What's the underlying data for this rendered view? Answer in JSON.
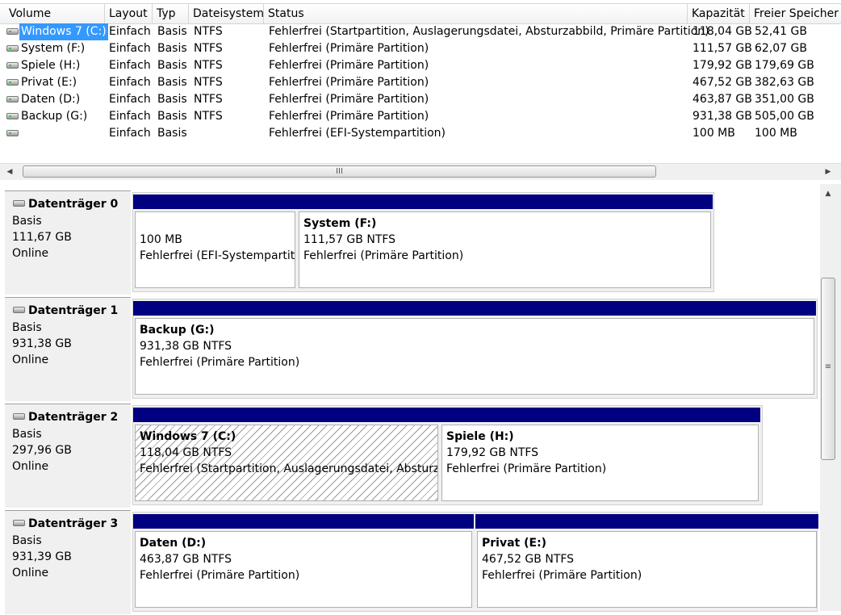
{
  "columns": [
    "Volume",
    "Layout",
    "Typ",
    "Dateisystem",
    "Status",
    "Kapazität",
    "Freier Speicher"
  ],
  "volumes": [
    {
      "name": "Windows 7 (C:)",
      "layout": "Einfach",
      "typ": "Basis",
      "fs": "NTFS",
      "status": "Fehlerfrei (Startpartition, Auslagerungsdatei, Absturzabbild, Primäre Partition)",
      "cap": "118,04 GB",
      "free": "52,41 GB"
    },
    {
      "name": "System (F:)",
      "layout": "Einfach",
      "typ": "Basis",
      "fs": "NTFS",
      "status": "Fehlerfrei (Primäre Partition)",
      "cap": "111,57 GB",
      "free": "62,07 GB"
    },
    {
      "name": "Spiele (H:)",
      "layout": "Einfach",
      "typ": "Basis",
      "fs": "NTFS",
      "status": "Fehlerfrei (Primäre Partition)",
      "cap": "179,92 GB",
      "free": "179,69 GB"
    },
    {
      "name": "Privat (E:)",
      "layout": "Einfach",
      "typ": "Basis",
      "fs": "NTFS",
      "status": "Fehlerfrei (Primäre Partition)",
      "cap": "467,52 GB",
      "free": "382,63 GB"
    },
    {
      "name": "Daten (D:)",
      "layout": "Einfach",
      "typ": "Basis",
      "fs": "NTFS",
      "status": "Fehlerfrei (Primäre Partition)",
      "cap": "463,87 GB",
      "free": "351,00 GB"
    },
    {
      "name": "Backup (G:)",
      "layout": "Einfach",
      "typ": "Basis",
      "fs": "NTFS",
      "status": "Fehlerfrei (Primäre Partition)",
      "cap": "931,38 GB",
      "free": "505,00 GB"
    },
    {
      "name": "",
      "layout": "Einfach",
      "typ": "Basis",
      "fs": "",
      "status": "Fehlerfrei (EFI-Systempartition)",
      "cap": "100 MB",
      "free": "100 MB"
    }
  ],
  "disks": [
    {
      "name": "Datenträger 0",
      "type": "Basis",
      "size": "111,67 GB",
      "state": "Online",
      "partitions": [
        {
          "name": "",
          "size": "100 MB",
          "status": "Fehlerfrei (EFI-Systempartition)"
        },
        {
          "name": "System  (F:)",
          "size": "111,57 GB NTFS",
          "status": "Fehlerfrei (Primäre Partition)"
        }
      ]
    },
    {
      "name": "Datenträger 1",
      "type": "Basis",
      "size": "931,38 GB",
      "state": "Online",
      "partitions": [
        {
          "name": "Backup  (G:)",
          "size": "931,38 GB NTFS",
          "status": "Fehlerfrei (Primäre Partition)"
        }
      ]
    },
    {
      "name": "Datenträger 2",
      "type": "Basis",
      "size": "297,96 GB",
      "state": "Online",
      "partitions": [
        {
          "name": "Windows 7  (C:)",
          "size": "118,04 GB NTFS",
          "status": "Fehlerfrei (Startpartition, Auslagerungsdatei, Absturzabbild, Primäre Partition)"
        },
        {
          "name": "Spiele  (H:)",
          "size": "179,92 GB NTFS",
          "status": "Fehlerfrei (Primäre Partition)"
        }
      ]
    },
    {
      "name": "Datenträger 3",
      "type": "Basis",
      "size": "931,39 GB",
      "state": "Online",
      "partitions": [
        {
          "name": "Daten  (D:)",
          "size": "463,87 GB NTFS",
          "status": "Fehlerfrei (Primäre Partition)"
        },
        {
          "name": "Privat  (E:)",
          "size": "467,52 GB NTFS",
          "status": "Fehlerfrei (Primäre Partition)"
        }
      ]
    }
  ],
  "scrollbar_grip": "III",
  "vscrollbar_grip": "≡",
  "colors": {
    "partition_bar": "#000080",
    "selection": "#3399ff"
  }
}
